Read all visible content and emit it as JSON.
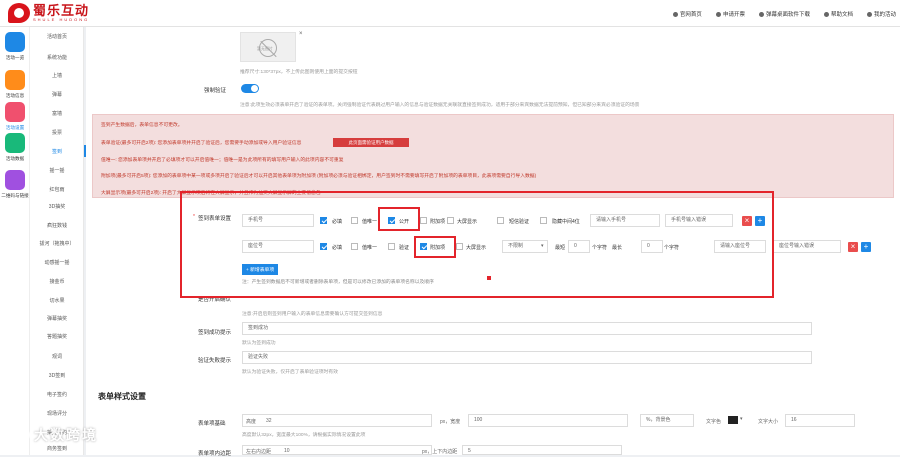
{
  "topbar": {
    "brand_cn": "蜀乐互动",
    "brand_en": "SHULE HUDONG",
    "links": [
      "官网首页",
      "申请开票",
      "弹幕桌面软件下载",
      "帮助文档",
      "我的活动"
    ]
  },
  "leftnav": [
    {
      "label": "活动一览",
      "color": "#1e88e5",
      "icon": "grid-icon"
    },
    {
      "label": "活动信息",
      "color": "#ff8c1a",
      "icon": "doc-icon"
    },
    {
      "label": "活动设置",
      "color": "#f0506e",
      "icon": "gear-icon"
    },
    {
      "label": "活动数据",
      "color": "#19b97a",
      "icon": "chart-icon"
    },
    {
      "label": "二维码与链接",
      "color": "#a050e0",
      "icon": "qrcode-icon"
    }
  ],
  "subnav": [
    "活动首页",
    "系统功能",
    "上墙",
    "弹幕",
    "富墙",
    "投票",
    "签到",
    "摇一摇",
    "红包雨",
    "3D抽奖",
    "疯狂数钱",
    "拔河（拖拽中）",
    "动感摇一摇",
    "接金币",
    "切水果",
    "弹幕抽奖",
    "答题抽奖",
    "观词",
    "3D签到",
    "电子签约",
    "现场评分",
    "抽奖签约",
    "商务签到"
  ],
  "upload": {
    "hint": "推荐尺寸:130*37px，不上传此图则使用上面的提交按钮",
    "placeholder": "暂无图片"
  },
  "force_verify": {
    "label": "强制验证",
    "hint": "注意:此项生效必须表单开启了验证的表单项。关闭强制验证代表跳过用户输入的信息与验证数据无关联就直接签到成功，适用于部分来宾数据无法提前预知，但已知部分来宾必须验证的场景"
  },
  "alert": {
    "line1": "签到产生数据后，表单信息不可更改。",
    "line2": "表单验证(最多可开启2项): 您添加表单项并开启了验证后，您需要手动添加或导入用户验证信息",
    "button": "此页面需验证用户数据",
    "line3": "值唯一: 您添加表单项并开启了必填项才可以开启值唯一；值唯一是为此项所有的填写用户输入的此项内容不可重复",
    "line4": "附加项(最多可开启5项): 您添加的表单项中某一项或多项开启了验证后才可以开启其他表单项为附加项 (附加项必须与验证相绑定，用户签到时不需要填写开启了附加项的表单项目，此表项需要自行导入数据)",
    "line5": "大屏显示项(最多可开启2项): 开启了大屏显示项后将在大屏显示，并且作为抽奖大屏显示屏的主要信息包"
  },
  "form_items": {
    "label": "签到表单设置",
    "row1": {
      "type": "手机号",
      "required": "必填",
      "unique": "值唯一",
      "public": "公开",
      "extra": "附加项",
      "screen": "大屏显示",
      "sms": "短信验证",
      "hide": "隐藏中间4位",
      "placeholder": "请输入手机号",
      "value": "手机号输入错误"
    },
    "row2": {
      "type": "座位号",
      "required": "必填",
      "unique": "值唯一",
      "verify": "验证",
      "extra": "附加项",
      "screen": "大屏显示",
      "rule": "不限制",
      "min_label": "最短",
      "min": "0",
      "max_label": "最长",
      "max": "0",
      "unit": "个字符",
      "placeholder": "请输入座位号",
      "value": "座位号输入错误"
    },
    "add_button": "+ 新增表单项",
    "note": "注：产生签到数据后不可新增或者删除表单项，但是可以修改已添加的表单项名称以及顺序"
  },
  "sign_confirm": {
    "label": "是否开启确认",
    "hint": "注意:开启后则签到用户输入的表单信息需要确认方可提交签到信息"
  },
  "sign_success": {
    "label": "签到成功提示",
    "value": "签到成功",
    "hint": "默认为签到成功"
  },
  "verify_fail": {
    "label": "验证失败提示",
    "value": "验证失败",
    "hint": "默认为验证失败，仅开启了表单验证项时有效"
  },
  "style_section": {
    "title": "表单样式设置"
  },
  "basic": {
    "label": "表单项基础",
    "height_label": "高度",
    "height": "32",
    "width_label": "px，宽度",
    "width": "100",
    "percent_label": "%，背景色",
    "text_color_label": "文字色",
    "font_size_label": "文字大小",
    "font_size": "16",
    "hint": "高度默认32px，宽度最大100%，请根据实际情况设置此项"
  },
  "padding": {
    "label": "表单项内边距",
    "lr_label": "左右内边距",
    "lr": "10",
    "tb_label": "px，上下内边距",
    "tb": "5"
  },
  "watermark": "大数跨境"
}
